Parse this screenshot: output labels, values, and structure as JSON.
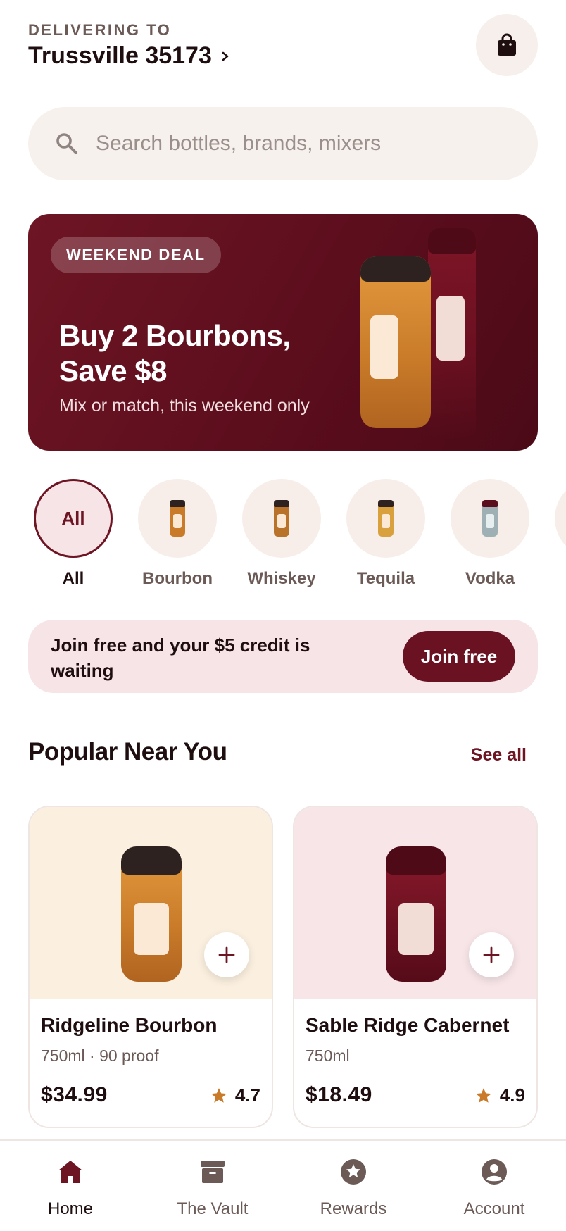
{
  "header": {
    "delivering_label": "DELIVERING TO",
    "location": "Trussville 35173",
    "icons": {
      "cart": "shopping-bag-icon",
      "chevron": "chevron-right-icon"
    }
  },
  "search": {
    "placeholder": "Search bottles, brands, mixers",
    "value": "",
    "icon": "search-icon"
  },
  "promo": {
    "badge": "WEEKEND DEAL",
    "title": "Buy 2 Bourbons, Save $8",
    "subtitle": "Mix or match, this weekend only"
  },
  "categories": [
    {
      "label": "All",
      "circle_text": "All",
      "active": true
    },
    {
      "label": "Bourbon",
      "active": false,
      "bottle_color": "#c97b29"
    },
    {
      "label": "Whiskey",
      "active": false,
      "bottle_color": "#b8722a"
    },
    {
      "label": "Tequila",
      "active": false,
      "bottle_color": "#d9a03e"
    },
    {
      "label": "Vodka",
      "active": false,
      "bottle_color": "#9fb0b4"
    }
  ],
  "join_banner": {
    "text": "Join free and your $5 credit is waiting",
    "button": "Join free"
  },
  "section": {
    "title": "Popular Near You",
    "see_all": "See all"
  },
  "products": [
    {
      "name": "Ridgeline Bourbon",
      "meta": "750ml · 90 proof",
      "price": "$34.99",
      "rating": "4.7"
    },
    {
      "name": "Sable Ridge Cabernet",
      "meta": "750ml",
      "price": "$18.49",
      "rating": "4.9"
    }
  ],
  "tabs": [
    {
      "label": "Home",
      "icon": "home-icon",
      "active": true
    },
    {
      "label": "The Vault",
      "icon": "archive-box-icon",
      "active": false
    },
    {
      "label": "Rewards",
      "icon": "star-badge-icon",
      "active": false
    },
    {
      "label": "Account",
      "icon": "user-icon",
      "active": false
    }
  ],
  "colors": {
    "brand": "#6e1524",
    "accent_star": "#c97b29",
    "text_primary": "#1e0e10",
    "text_secondary": "#6b5a56"
  }
}
